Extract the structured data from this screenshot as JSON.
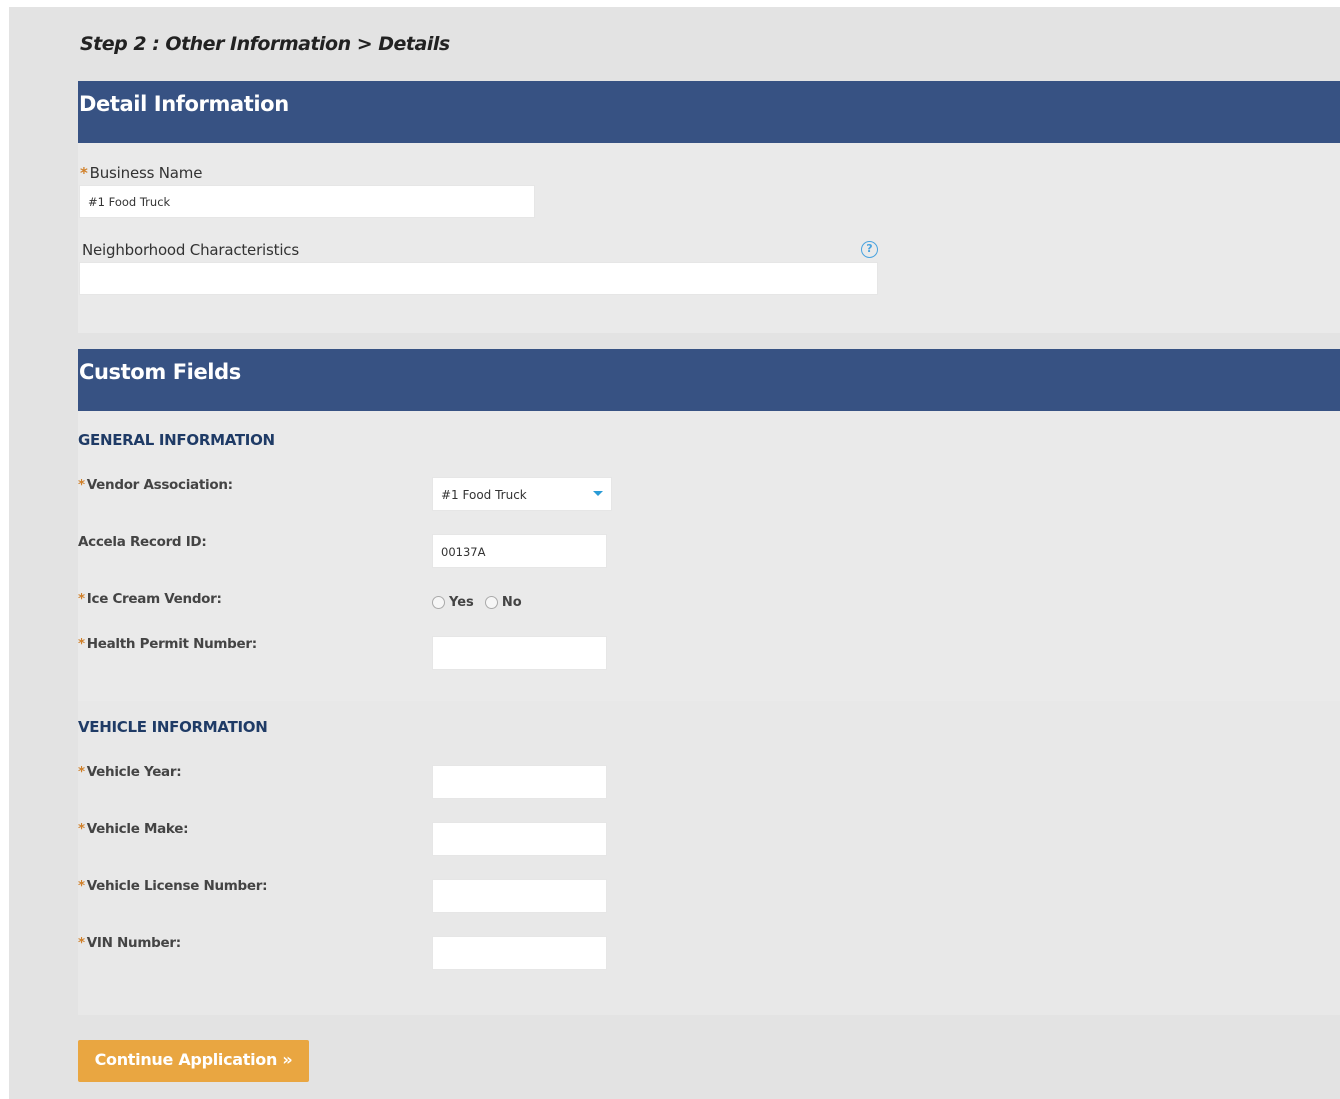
{
  "step": {
    "title": "Step 2 : Other Information > Details"
  },
  "detail_section": {
    "header": "Detail Information",
    "business_name": {
      "label": "Business Name",
      "required_mark": "*",
      "value": "#1 Food Truck"
    },
    "neighborhood": {
      "label": "Neighborhood Characteristics",
      "value": "",
      "help_icon": "?"
    }
  },
  "custom_section": {
    "header": "Custom Fields",
    "general": {
      "title": "GENERAL INFORMATION",
      "vendor_association": {
        "label": "Vendor Association:",
        "required_mark": "*",
        "value": "#1 Food Truck"
      },
      "accela_record_id": {
        "label": "Accela Record ID:",
        "value": "00137A"
      },
      "ice_cream_vendor": {
        "label": "Ice Cream Vendor:",
        "required_mark": "*",
        "options": [
          "Yes",
          "No"
        ]
      },
      "health_permit": {
        "label": "Health Permit Number:",
        "required_mark": "*",
        "value": ""
      }
    },
    "vehicle": {
      "title": "VEHICLE INFORMATION",
      "year": {
        "label": "Vehicle Year:",
        "required_mark": "*",
        "value": ""
      },
      "make": {
        "label": "Vehicle Make:",
        "required_mark": "*",
        "value": ""
      },
      "license": {
        "label": "Vehicle License Number:",
        "required_mark": "*",
        "value": ""
      },
      "vin": {
        "label": "VIN Number:",
        "required_mark": "*",
        "value": ""
      }
    }
  },
  "actions": {
    "continue_label": "Continue Application »"
  },
  "colors": {
    "header_bg": "#375283",
    "button_bg": "#e9a641",
    "required": "#d0802a",
    "subhead": "#1f3b66"
  }
}
